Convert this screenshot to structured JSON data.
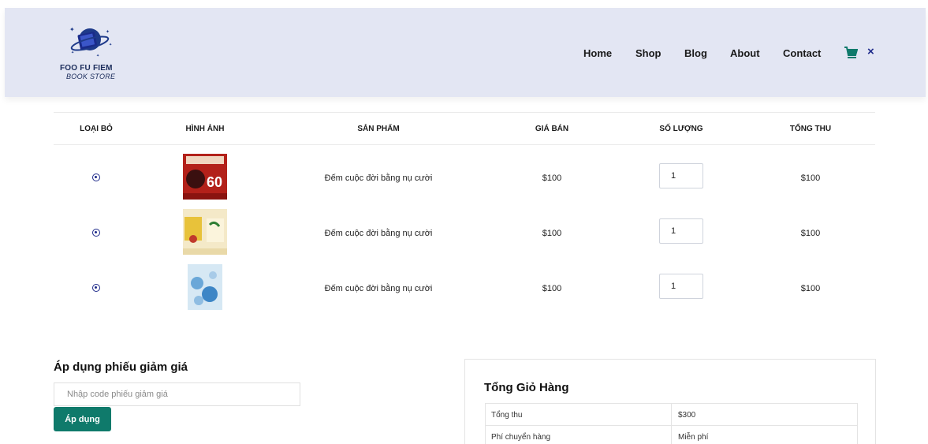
{
  "brand": {
    "line1": "FOO FU FIEM",
    "line2": "BOOK STORE",
    "accent": "#1a2b5a"
  },
  "nav": {
    "items": [
      "Home",
      "Shop",
      "Blog",
      "About",
      "Contact"
    ],
    "cart_icon": "cart-icon",
    "close_icon": "close-icon",
    "close_glyph": "×"
  },
  "cart": {
    "headers": [
      "LOẠI BỎ",
      "HÌNH ẢNH",
      "SẢN PHẨM",
      "GIÁ BÁN",
      "SỐ LƯỢNG",
      "TỔNG THU"
    ],
    "rows": [
      {
        "product": "Đếm cuộc đời bằng nụ cười",
        "price": "$100",
        "qty": "1",
        "total": "$100"
      },
      {
        "product": "Đếm cuộc đời bằng nụ cười",
        "price": "$100",
        "qty": "1",
        "total": "$100"
      },
      {
        "product": "Đếm cuộc đời bằng nụ cười",
        "price": "$100",
        "qty": "1",
        "total": "$100"
      }
    ]
  },
  "coupon": {
    "title": "Áp dụng phiếu giảm giá",
    "placeholder": "Nhập code phiếu giảm giá",
    "button": "Áp dụng"
  },
  "totals": {
    "title": "Tổng Giỏ Hàng",
    "rows": [
      {
        "label": "Tổng thu",
        "value": "$300"
      },
      {
        "label": "Phí chuyển hàng",
        "value": "Miễn phí"
      }
    ]
  },
  "colors": {
    "header_bg": "#e3e6f3",
    "primary": "#0f7a6b",
    "icon_blue": "#1e2a8a"
  }
}
